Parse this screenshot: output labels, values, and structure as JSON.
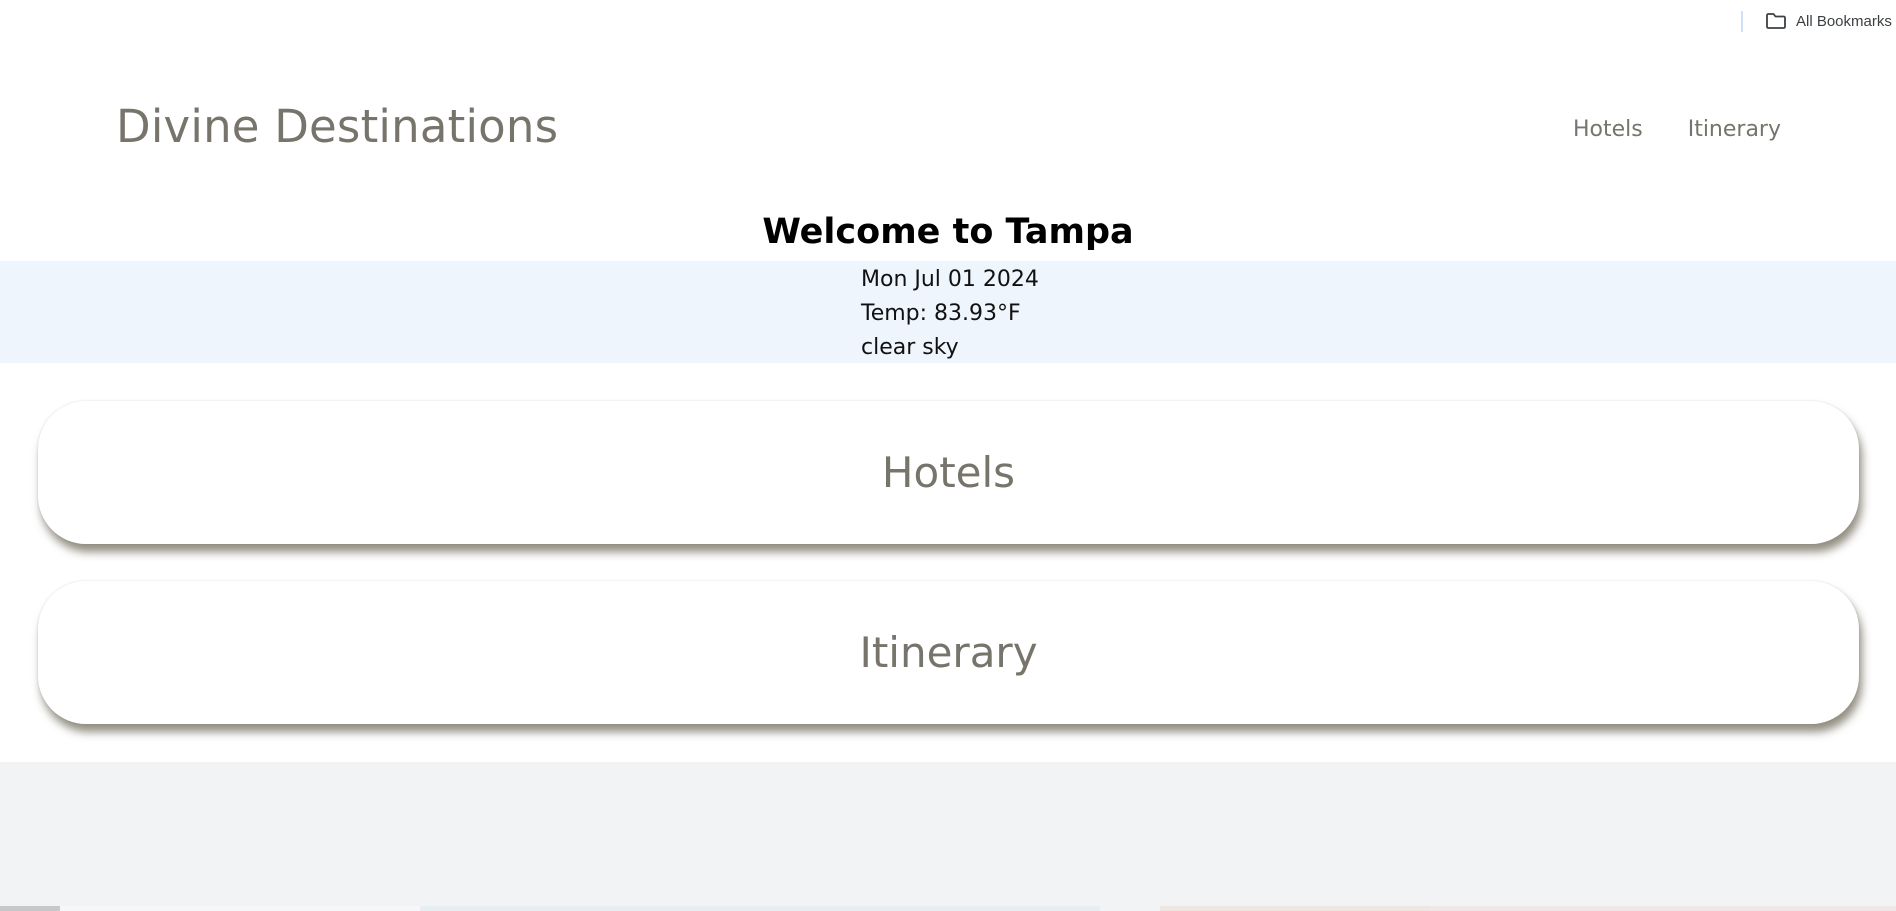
{
  "bookmarks_bar": {
    "all_bookmarks_label": "All Bookmarks",
    "icon": "folder-icon"
  },
  "header": {
    "logo": "Divine Destinations",
    "nav": [
      {
        "label": "Hotels"
      },
      {
        "label": "Itinerary"
      }
    ]
  },
  "welcome": {
    "title": "Welcome to Tampa"
  },
  "weather": {
    "date": "Mon Jul 01 2024",
    "temp": "Temp: 83.93°F",
    "description": "clear sky"
  },
  "cards": [
    {
      "label": "Hotels"
    },
    {
      "label": "Itinerary"
    }
  ],
  "colors": {
    "brand_text": "#77746c",
    "weather_band": "#eef5fd",
    "footer_bg": "#f1f3f4"
  }
}
